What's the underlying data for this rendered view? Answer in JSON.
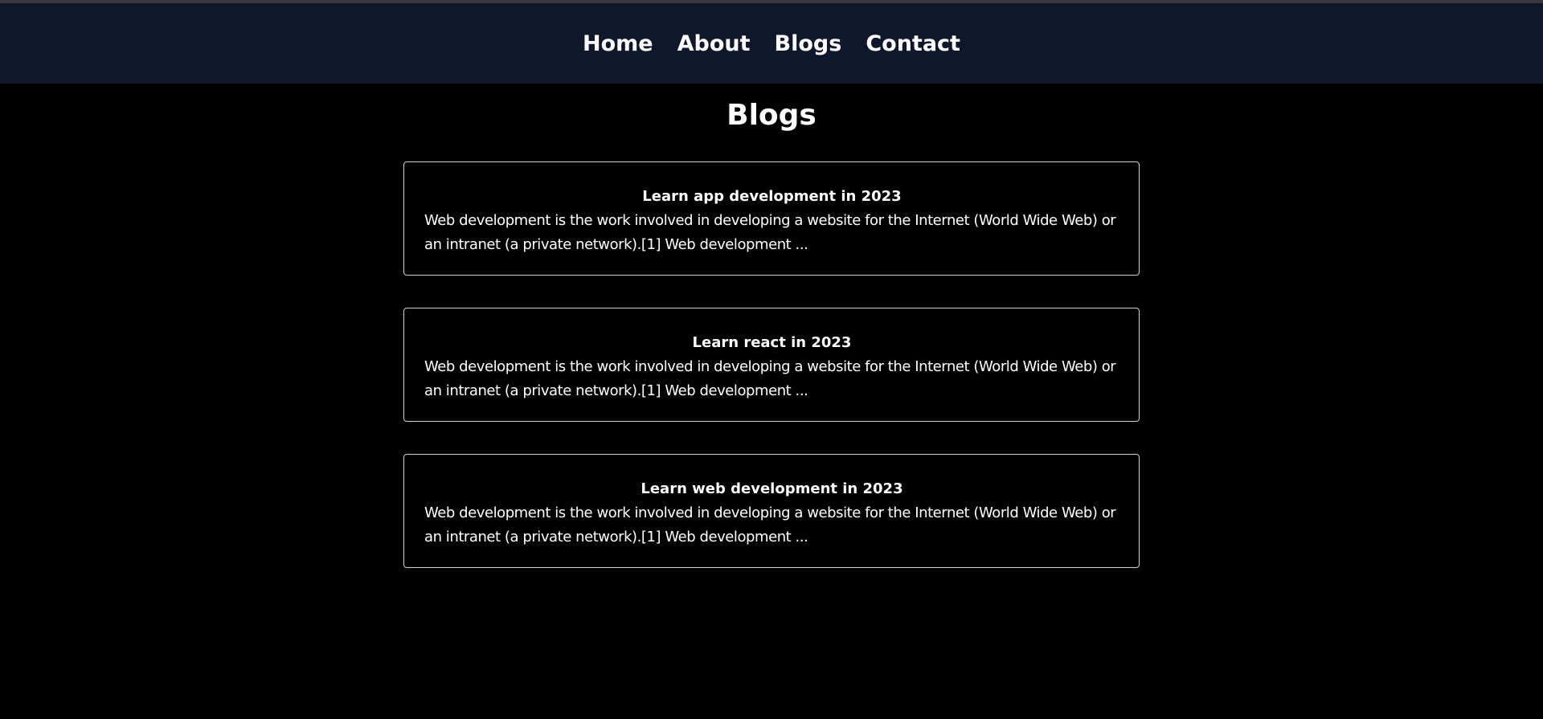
{
  "nav": {
    "items": [
      {
        "label": "Home",
        "accent": "#ffffff"
      },
      {
        "label": "About",
        "accent": "#ffffff"
      },
      {
        "label": "Blogs",
        "accent": "#ffffff"
      },
      {
        "label": "Contact",
        "accent": "#ffffff"
      }
    ],
    "background": "#0f172a"
  },
  "page": {
    "title": "Blogs",
    "background": "#000000"
  },
  "blogs": [
    {
      "title": "Learn app development in 2023",
      "excerpt": "Web development is the work involved in developing a website for the Internet (World Wide Web) or an intranet (a private network).[1] Web development ..."
    },
    {
      "title": "Learn react in 2023",
      "excerpt": "Web development is the work involved in developing a website for the Internet (World Wide Web) or an intranet (a private network).[1] Web development ..."
    },
    {
      "title": "Learn web development in 2023",
      "excerpt": "Web development is the work involved in developing a website for the Internet (World Wide Web) or an intranet (a private network).[1] Web development ..."
    }
  ]
}
